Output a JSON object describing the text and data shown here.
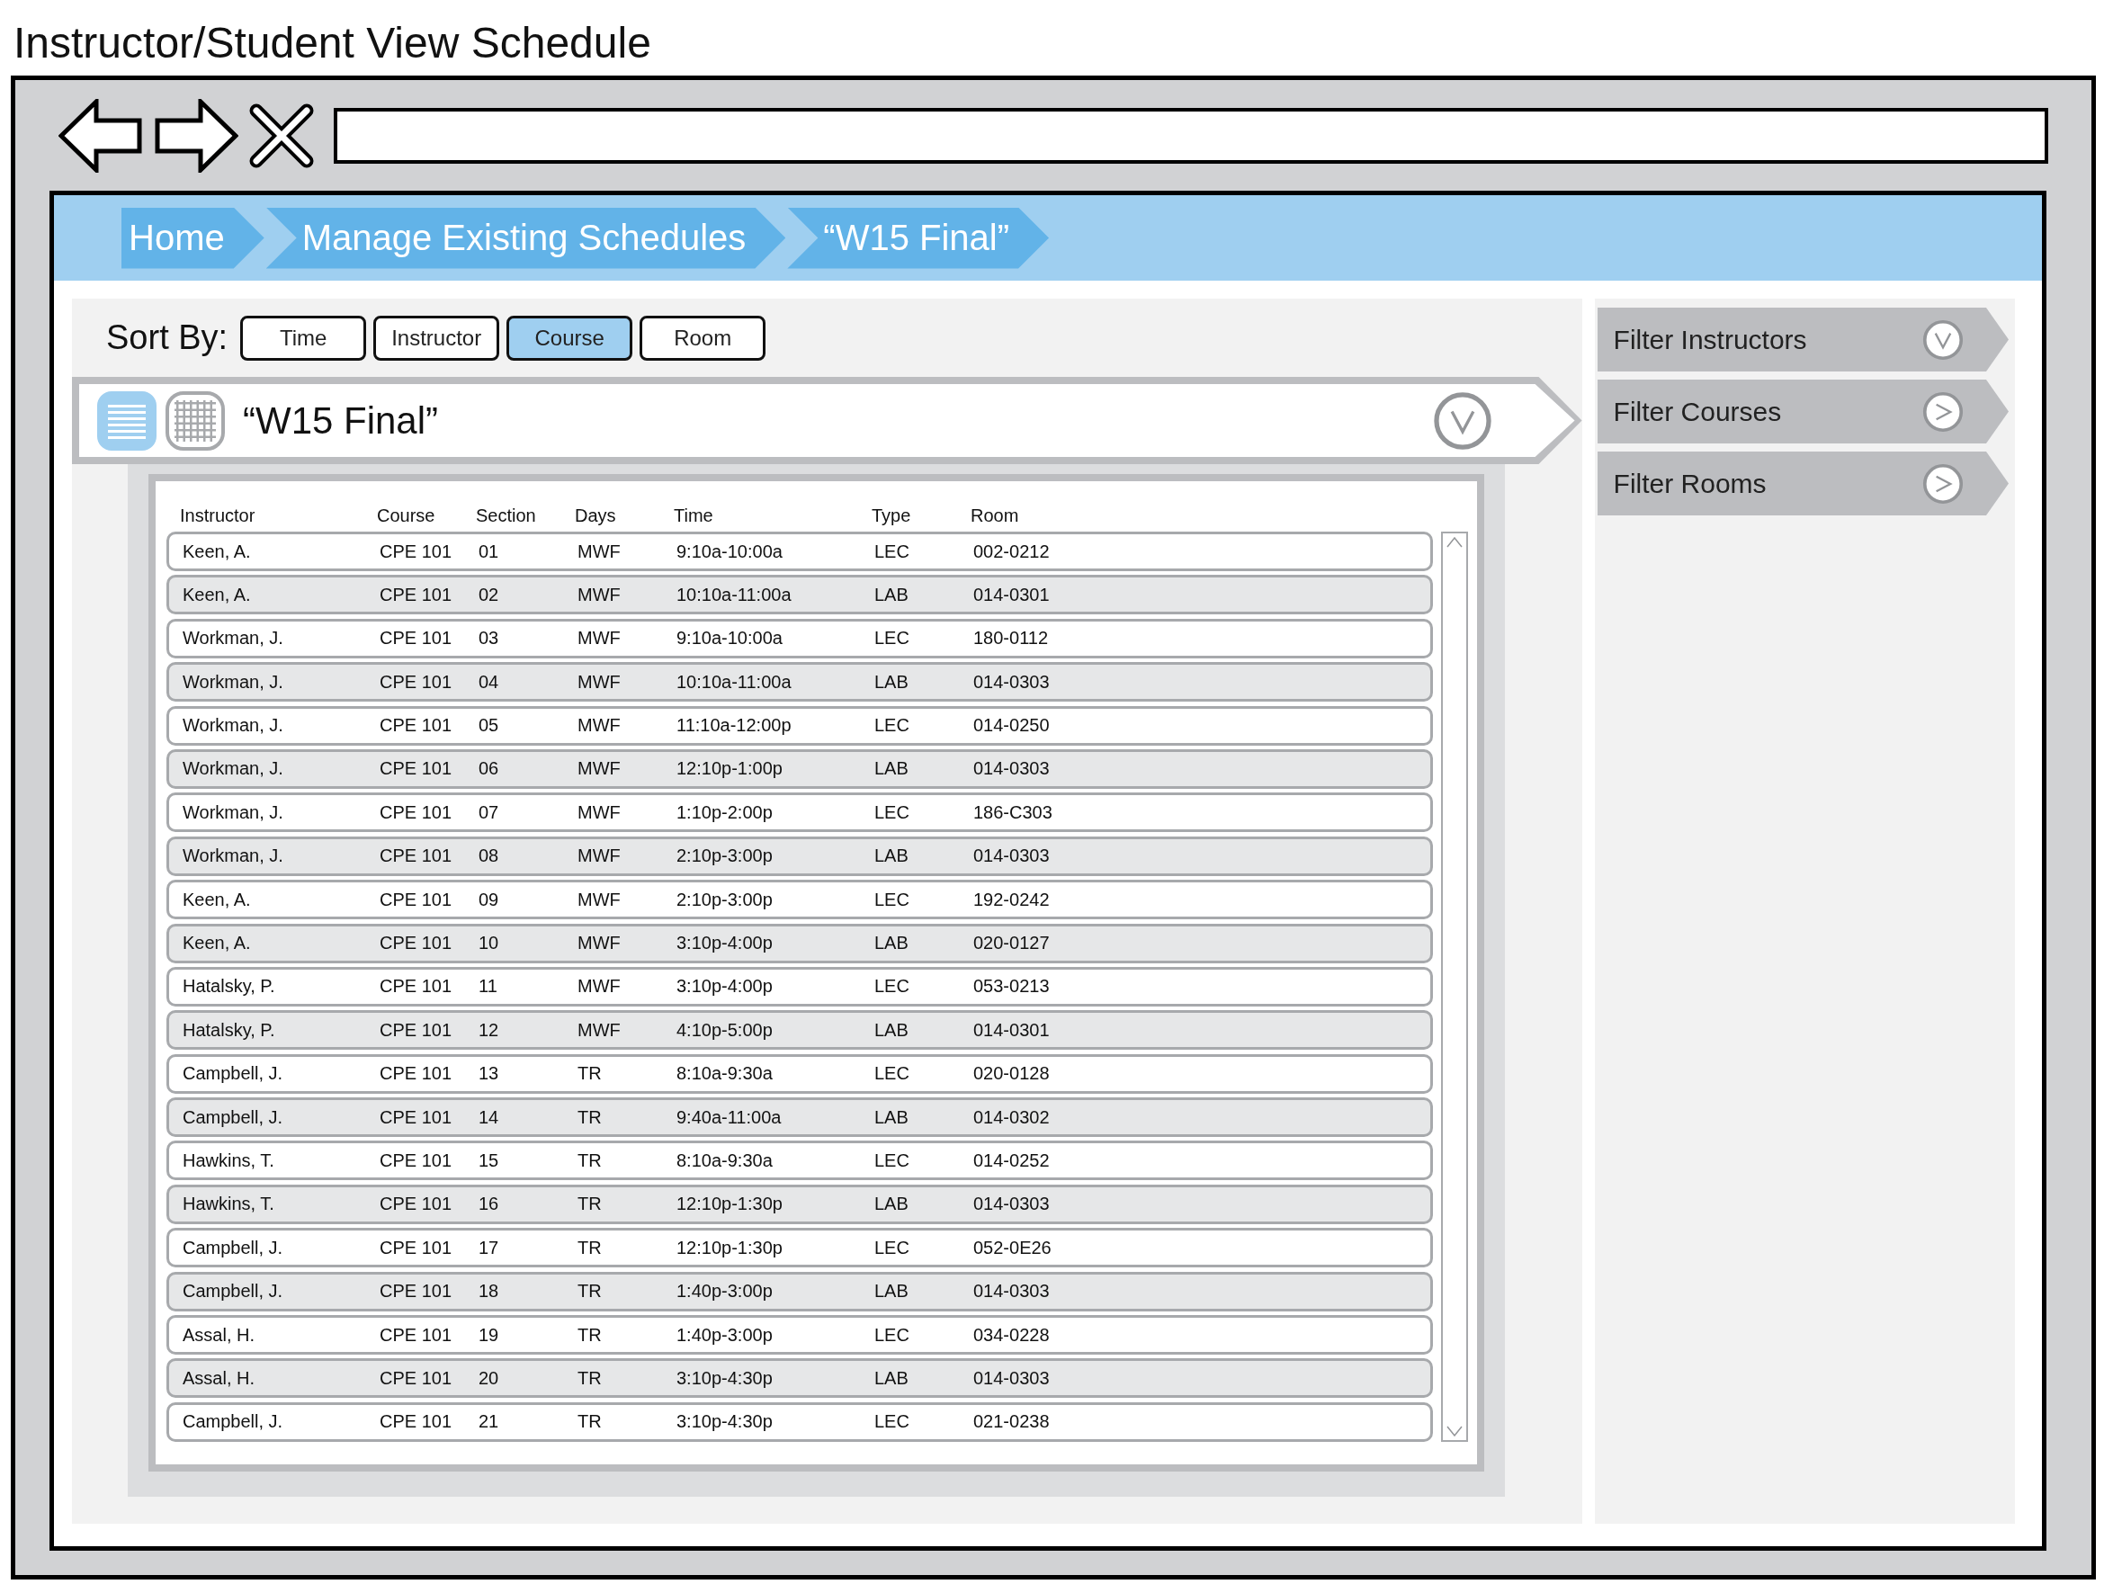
{
  "page_title": "Instructor/Student View Schedule",
  "breadcrumbs": [
    {
      "label": "Home"
    },
    {
      "label": "Manage Existing Schedules"
    },
    {
      "label": "“W15 Final”"
    }
  ],
  "sort_by": {
    "label": "Sort By:",
    "options": [
      {
        "label": "Time",
        "selected": false
      },
      {
        "label": "Instructor",
        "selected": false
      },
      {
        "label": "Course",
        "selected": true
      },
      {
        "label": "Room",
        "selected": false
      }
    ]
  },
  "schedule": {
    "title": "“W15 Final”",
    "expanded": true,
    "views": [
      {
        "kind": "list",
        "selected": true
      },
      {
        "kind": "grid",
        "selected": false
      }
    ]
  },
  "table": {
    "columns": [
      "Instructor",
      "Course",
      "Section",
      "Days",
      "Time",
      "Type",
      "Room"
    ],
    "rows": [
      [
        "Keen, A.",
        "CPE 101",
        "01",
        "MWF",
        "9:10a-10:00a",
        "LEC",
        "002-0212"
      ],
      [
        "Keen, A.",
        "CPE 101",
        "02",
        "MWF",
        "10:10a-11:00a",
        "LAB",
        "014-0301"
      ],
      [
        "Workman, J.",
        "CPE 101",
        "03",
        "MWF",
        "9:10a-10:00a",
        "LEC",
        "180-0112"
      ],
      [
        "Workman, J.",
        "CPE 101",
        "04",
        "MWF",
        "10:10a-11:00a",
        "LAB",
        "014-0303"
      ],
      [
        "Workman, J.",
        "CPE 101",
        "05",
        "MWF",
        "11:10a-12:00p",
        "LEC",
        "014-0250"
      ],
      [
        "Workman, J.",
        "CPE 101",
        "06",
        "MWF",
        "12:10p-1:00p",
        "LAB",
        "014-0303"
      ],
      [
        "Workman, J.",
        "CPE 101",
        "07",
        "MWF",
        "1:10p-2:00p",
        "LEC",
        "186-C303"
      ],
      [
        "Workman, J.",
        "CPE 101",
        "08",
        "MWF",
        "2:10p-3:00p",
        "LAB",
        "014-0303"
      ],
      [
        "Keen, A.",
        "CPE 101",
        "09",
        "MWF",
        "2:10p-3:00p",
        "LEC",
        "192-0242"
      ],
      [
        "Keen, A.",
        "CPE 101",
        "10",
        "MWF",
        "3:10p-4:00p",
        "LAB",
        "020-0127"
      ],
      [
        "Hatalsky, P.",
        "CPE 101",
        "11",
        "MWF",
        "3:10p-4:00p",
        "LEC",
        "053-0213"
      ],
      [
        "Hatalsky, P.",
        "CPE 101",
        "12",
        "MWF",
        "4:10p-5:00p",
        "LAB",
        "014-0301"
      ],
      [
        "Campbell, J.",
        "CPE 101",
        "13",
        "TR",
        "8:10a-9:30a",
        "LEC",
        "020-0128"
      ],
      [
        "Campbell, J.",
        "CPE 101",
        "14",
        "TR",
        "9:40a-11:00a",
        "LAB",
        "014-0302"
      ],
      [
        "Hawkins, T.",
        "CPE 101",
        "15",
        "TR",
        "8:10a-9:30a",
        "LEC",
        "014-0252"
      ],
      [
        "Hawkins, T.",
        "CPE 101",
        "16",
        "TR",
        "12:10p-1:30p",
        "LAB",
        "014-0303"
      ],
      [
        "Campbell, J.",
        "CPE 101",
        "17",
        "TR",
        "12:10p-1:30p",
        "LEC",
        "052-0E26"
      ],
      [
        "Campbell, J.",
        "CPE 101",
        "18",
        "TR",
        "1:40p-3:00p",
        "LAB",
        "014-0303"
      ],
      [
        "Assal, H.",
        "CPE 101",
        "19",
        "TR",
        "1:40p-3:00p",
        "LEC",
        "034-0228"
      ],
      [
        "Assal, H.",
        "CPE 101",
        "20",
        "TR",
        "3:10p-4:30p",
        "LAB",
        "014-0303"
      ],
      [
        "Campbell, J.",
        "CPE 101",
        "21",
        "TR",
        "3:10p-4:30p",
        "LEC",
        "021-0238"
      ]
    ]
  },
  "filters": [
    {
      "label": "Filter Instructors",
      "expanded": true
    },
    {
      "label": "Filter Courses",
      "expanded": false
    },
    {
      "label": "Filter Rooms",
      "expanded": false
    }
  ]
}
